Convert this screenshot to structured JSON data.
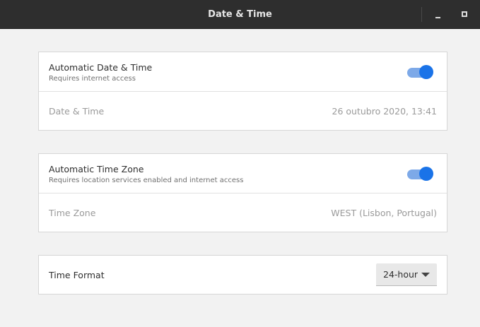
{
  "window": {
    "title": "Date & Time"
  },
  "auto_datetime": {
    "label": "Automatic Date & Time",
    "sublabel": "Requires internet access",
    "enabled": true
  },
  "datetime": {
    "label": "Date & Time",
    "value": "26 outubro 2020, 13:41"
  },
  "auto_timezone": {
    "label": "Automatic Time Zone",
    "sublabel": "Requires location services enabled and internet access",
    "enabled": true
  },
  "timezone": {
    "label": "Time Zone",
    "value": "WEST (Lisbon, Portugal)"
  },
  "time_format": {
    "label": "Time Format",
    "selected": "24-hour"
  },
  "colors": {
    "accent": "#1a73e8",
    "accent_track": "#7da9e8",
    "titlebar": "#2e2e2e",
    "background": "#f2f2f2"
  },
  "icons": {
    "minimize": "minimize-icon",
    "maximize": "maximize-icon",
    "dropdown": "chevron-down-icon"
  }
}
